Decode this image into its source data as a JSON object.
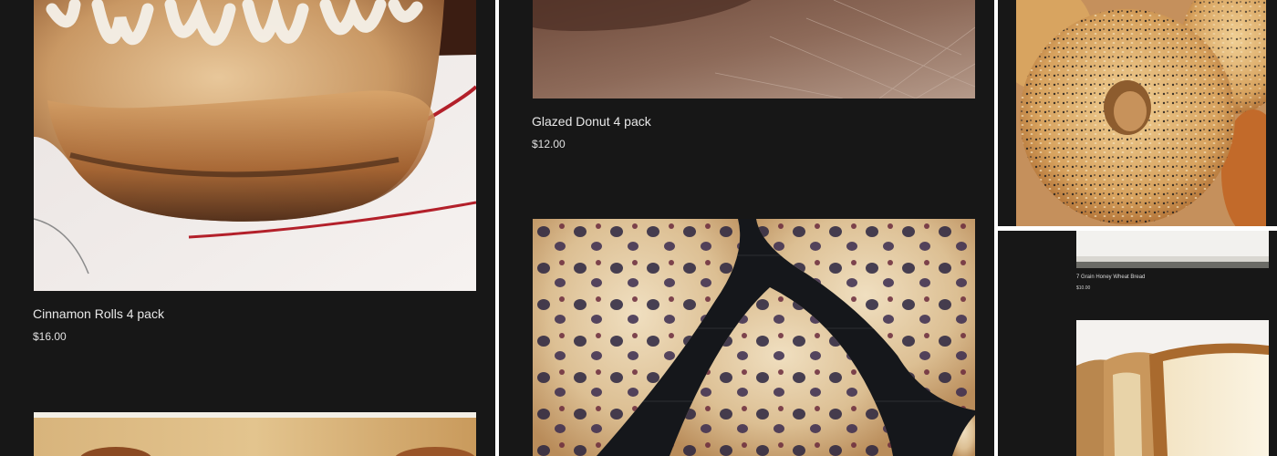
{
  "panels": {
    "left": {
      "product_1": {
        "title": "Cinnamon Rolls 4 pack",
        "price": "$16.00",
        "image": "cinnamon-rolls-photo"
      },
      "product_2": {
        "image": "muffins-photo"
      }
    },
    "middle": {
      "product_1": {
        "title": "Glazed Donut 4 pack",
        "price": "$12.00",
        "image": "glazed-donut-photo"
      },
      "product_2": {
        "image": "blueberry-scones-photo"
      }
    },
    "right_top": {
      "product_1": {
        "image": "bagels-photo"
      }
    },
    "right_bottom": {
      "product_1": {
        "title": "7 Grain Honey Wheat Bread",
        "price": "$10.00",
        "image": "wheat-bread-photo"
      },
      "product_2": {
        "image": "bread-loaf-photo"
      }
    }
  },
  "colors": {
    "background": "#171717",
    "separator": "#ffffff",
    "title_text": "#e8e8e8",
    "price_text": "#e0e0e0"
  }
}
